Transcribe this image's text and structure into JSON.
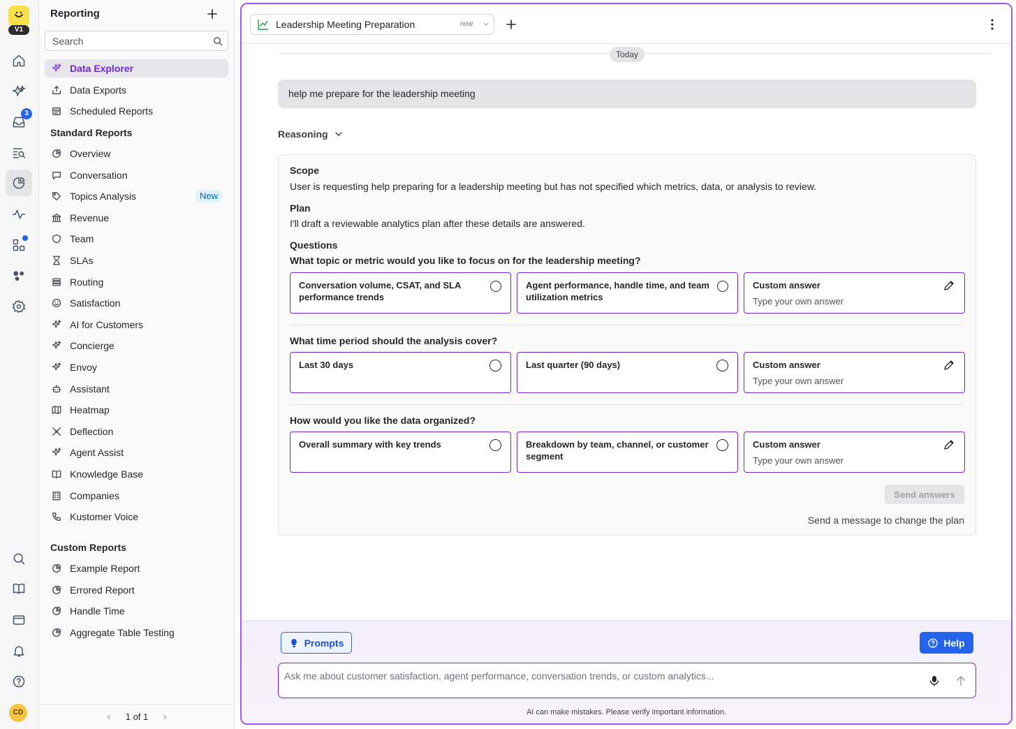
{
  "app": {
    "version_badge": "V1",
    "inbox_badge": "3",
    "avatar_initials": "CD",
    "accent_color": "#7c3aed",
    "primary_color": "#2463eb"
  },
  "rail": {
    "icons": [
      "home-icon",
      "ai-sparkle-icon",
      "inbox-icon",
      "search-list-icon",
      "reporting-pie-icon",
      "activity-icon",
      "apps-grid-icon",
      "integrations-icon",
      "settings-icon",
      "search-icon",
      "knowledge-book-icon",
      "window-icon",
      "bell-icon",
      "help-icon"
    ]
  },
  "sidebar": {
    "title": "Reporting",
    "search_placeholder": "Search",
    "top_items": [
      {
        "label": "Data Explorer",
        "icon": "sparkle-icon",
        "active": true
      },
      {
        "label": "Data Exports",
        "icon": "export-icon"
      },
      {
        "label": "Scheduled Reports",
        "icon": "calendar-icon"
      }
    ],
    "standard_heading": "Standard Reports",
    "standard_items": [
      {
        "label": "Overview",
        "icon": "pie-icon"
      },
      {
        "label": "Conversation",
        "icon": "chat-icon"
      },
      {
        "label": "Topics Analysis",
        "icon": "tag-icon",
        "badge": "New"
      },
      {
        "label": "Revenue",
        "icon": "bank-icon"
      },
      {
        "label": "Team",
        "icon": "shield-icon"
      },
      {
        "label": "SLAs",
        "icon": "hourglass-icon"
      },
      {
        "label": "Routing",
        "icon": "routing-icon"
      },
      {
        "label": "Satisfaction",
        "icon": "smile-icon"
      },
      {
        "label": "AI for Customers",
        "icon": "sparkle-icon"
      },
      {
        "label": "Concierge",
        "icon": "sparkle-icon"
      },
      {
        "label": "Envoy",
        "icon": "sparkle-icon"
      },
      {
        "label": "Assistant",
        "icon": "robot-icon"
      },
      {
        "label": "Heatmap",
        "icon": "map-icon"
      },
      {
        "label": "Deflection",
        "icon": "deflection-icon"
      },
      {
        "label": "Agent Assist",
        "icon": "sparkle-icon"
      },
      {
        "label": "Knowledge Base",
        "icon": "book-icon"
      },
      {
        "label": "Companies",
        "icon": "building-icon"
      },
      {
        "label": "Kustomer Voice",
        "icon": "phone-icon"
      }
    ],
    "custom_heading": "Custom Reports",
    "custom_items": [
      {
        "label": "Example Report",
        "icon": "pie-icon"
      },
      {
        "label": "Errored Report",
        "icon": "pie-icon"
      },
      {
        "label": "Handle Time",
        "icon": "pie-icon"
      },
      {
        "label": "Aggregate Table Testing",
        "icon": "pie-icon"
      }
    ],
    "pager": "1 of 1"
  },
  "tab": {
    "title": "Leadership Meeting Preparation",
    "time": "now"
  },
  "chat": {
    "day_label": "Today",
    "user_message": "help me prepare for the leadership meeting",
    "reasoning_label": "Reasoning",
    "scope_label": "Scope",
    "scope_text": "User is requesting help preparing for a leadership meeting but has not specified which metrics, data, or analysis to review.",
    "plan_label": "Plan",
    "plan_text": "I'll draft a reviewable analytics plan after these details are answered.",
    "questions_label": "Questions",
    "questions": [
      {
        "text": "What topic or metric would you like to focus on for the leadership meeting?",
        "options": [
          "Conversation volume, CSAT, and SLA performance trends",
          "Agent performance, handle time, and team utilization metrics"
        ]
      },
      {
        "text": "What time period should the analysis cover?",
        "options": [
          "Last 30 days",
          "Last quarter (90 days)"
        ]
      },
      {
        "text": "How would you like the data organized?",
        "options": [
          "Overall summary with key trends",
          "Breakdown by team, channel, or customer segment"
        ]
      }
    ],
    "custom_answer_label": "Custom answer",
    "custom_answer_placeholder": "Type your own answer",
    "send_label": "Send answers",
    "change_hint": "Send a message to change the plan"
  },
  "composer": {
    "prompts_label": "Prompts",
    "help_label": "Help",
    "placeholder": "Ask me about customer satisfaction, agent performance, conversation trends, or custom analytics...",
    "disclaimer": "AI can make mistakes. Please verify important information."
  }
}
